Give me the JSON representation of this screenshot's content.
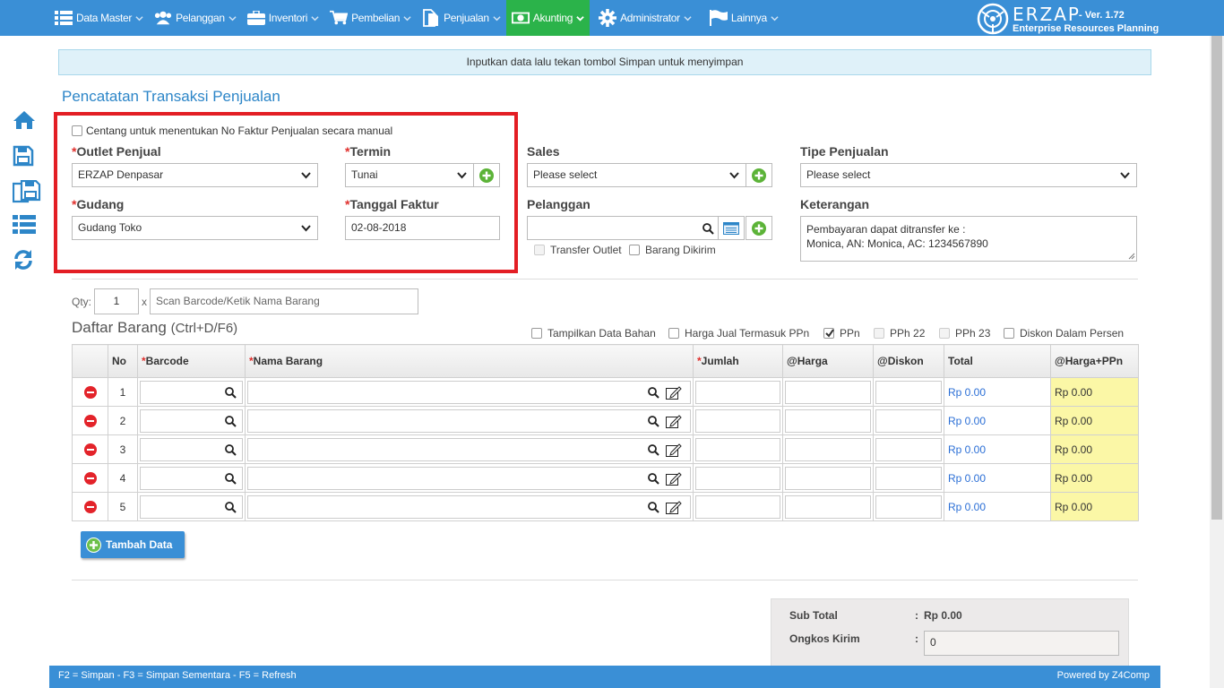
{
  "navbar": {
    "items": [
      {
        "label": "Data Master",
        "icon": "list-icon"
      },
      {
        "label": "Pelanggan",
        "icon": "users-icon"
      },
      {
        "label": "Inventori",
        "icon": "briefcase-icon"
      },
      {
        "label": "Pembelian",
        "icon": "cart-icon"
      },
      {
        "label": "Penjualan",
        "icon": "document-icon"
      },
      {
        "label": "Akunting",
        "icon": "money-icon",
        "active": true
      },
      {
        "label": "Administrator",
        "icon": "gear-icon"
      },
      {
        "label": "Lainnya",
        "icon": "flag-icon"
      }
    ],
    "brand": {
      "logo_text": "ERZAP",
      "version": "- Ver. 1.72",
      "subtitle": "Enterprise Resources Planning"
    }
  },
  "info_message": "Inputkan data lalu tekan tombol Simpan untuk menyimpan",
  "page_title": "Pencatatan Transaksi Penjualan",
  "form": {
    "manual_invoice_label": "Centang untuk menentukan No Faktur Penjualan secara manual",
    "outlet": {
      "label": "Outlet Penjual",
      "value": "ERZAP Denpasar"
    },
    "termin": {
      "label": "Termin",
      "value": "Tunai"
    },
    "gudang": {
      "label": "Gudang",
      "value": "Gudang Toko"
    },
    "tanggal": {
      "label": "Tanggal Faktur",
      "value": "02-08-2018"
    },
    "sales": {
      "label": "Sales",
      "value": "Please select"
    },
    "pelanggan": {
      "label": "Pelanggan",
      "value": ""
    },
    "transfer_outlet": "Transfer Outlet",
    "barang_dikirim": "Barang Dikirim",
    "tipe": {
      "label": "Tipe Penjualan",
      "value": "Please select"
    },
    "keterangan": {
      "label": "Keterangan",
      "line1": "Pembayaran dapat ditransfer ke :",
      "line2": "Monica, AN: Monica, AC: 1234567890"
    }
  },
  "qty": {
    "label": "Qty:",
    "value": "1",
    "times": "x",
    "scan_placeholder": "Scan Barcode/Ketik Nama Barang"
  },
  "list": {
    "title": "Daftar Barang",
    "shortcut": "(Ctrl+D/F6)",
    "options": [
      {
        "label": "Tampilkan Data Bahan",
        "checked": false,
        "disabled": false
      },
      {
        "label": "Harga Jual Termasuk PPn",
        "checked": false,
        "disabled": false
      },
      {
        "label": "PPn",
        "checked": true,
        "disabled": false
      },
      {
        "label": "PPh 22",
        "checked": false,
        "disabled": true
      },
      {
        "label": "PPh 23",
        "checked": false,
        "disabled": true
      },
      {
        "label": "Diskon Dalam Persen",
        "checked": false,
        "disabled": false
      }
    ],
    "columns": {
      "no": "No",
      "barcode": "Barcode",
      "nama": "Nama Barang",
      "jumlah": "Jumlah",
      "harga": "@Harga",
      "diskon": "@Diskon",
      "total": "Total",
      "harga_ppn": "@Harga+PPn"
    },
    "rows": [
      {
        "no": "1",
        "total": "Rp 0.00",
        "harga_ppn": "Rp 0.00"
      },
      {
        "no": "2",
        "total": "Rp 0.00",
        "harga_ppn": "Rp 0.00"
      },
      {
        "no": "3",
        "total": "Rp 0.00",
        "harga_ppn": "Rp 0.00"
      },
      {
        "no": "4",
        "total": "Rp 0.00",
        "harga_ppn": "Rp 0.00"
      },
      {
        "no": "5",
        "total": "Rp 0.00",
        "harga_ppn": "Rp 0.00"
      }
    ],
    "add_button": "Tambah Data"
  },
  "summary": {
    "subtotal_label": "Sub Total",
    "subtotal_colon": ":",
    "subtotal_value": "Rp 0.00",
    "ongkos_label": "Ongkos Kirim",
    "ongkos_colon": ":",
    "ongkos_value": "0"
  },
  "footer": {
    "shortcuts": "F2 = Simpan - F3 = Simpan Sementara - F5 = Refresh",
    "powered": "Powered by Z4Comp"
  },
  "colors": {
    "primary": "#3a8fd6",
    "active": "#2bb34a",
    "title": "#2d86c8",
    "highlight": "#e31e24",
    "ppn_cell": "#fbf7a6"
  }
}
